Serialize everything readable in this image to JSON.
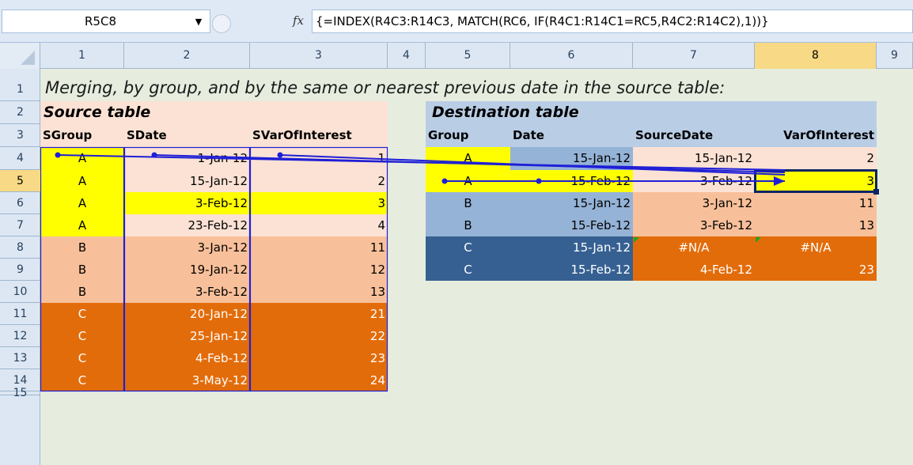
{
  "formula_bar": {
    "name_box": "R5C8",
    "fx_icon": "fx-icon",
    "formula": "{=INDEX(R4C3:R14C3, MATCH(RC6, IF(R4C1:R14C1=RC5,R4C2:R14C2),1))}"
  },
  "columns": [
    "1",
    "2",
    "3",
    "4",
    "5",
    "6",
    "7",
    "8",
    "9"
  ],
  "rows": [
    "1",
    "2",
    "3",
    "4",
    "5",
    "6",
    "7",
    "8",
    "9",
    "10",
    "11",
    "12",
    "13",
    "14",
    "15"
  ],
  "title": "Merging, by group, and by the same or nearest previous date in the source table:",
  "source": {
    "heading": "Source table",
    "headers": [
      "SGroup",
      "SDate",
      "SVarOfInterest"
    ],
    "rows": [
      [
        "A",
        "1-Jan-12",
        "1"
      ],
      [
        "A",
        "15-Jan-12",
        "2"
      ],
      [
        "A",
        "3-Feb-12",
        "3"
      ],
      [
        "A",
        "23-Feb-12",
        "4"
      ],
      [
        "B",
        "3-Jan-12",
        "11"
      ],
      [
        "B",
        "19-Jan-12",
        "12"
      ],
      [
        "B",
        "3-Feb-12",
        "13"
      ],
      [
        "C",
        "20-Jan-12",
        "21"
      ],
      [
        "C",
        "25-Jan-12",
        "22"
      ],
      [
        "C",
        "4-Feb-12",
        "23"
      ],
      [
        "C",
        "3-May-12",
        "24"
      ]
    ]
  },
  "destination": {
    "heading": "Destination table",
    "headers": [
      "Group",
      "Date",
      "SourceDate",
      "VarOfInterest"
    ],
    "rows": [
      [
        "A",
        "15-Jan-12",
        "15-Jan-12",
        "2"
      ],
      [
        "A",
        "15-Feb-12",
        "3-Feb-12",
        "3"
      ],
      [
        "B",
        "15-Jan-12",
        "3-Jan-12",
        "11"
      ],
      [
        "B",
        "15-Feb-12",
        "3-Feb-12",
        "13"
      ],
      [
        "C",
        "15-Jan-12",
        "#N/A",
        "#N/A"
      ],
      [
        "C",
        "15-Feb-12",
        "4-Feb-12",
        "23"
      ]
    ]
  },
  "colors": {
    "peach": "#fbe2d4",
    "orange_light": "#f8c09a",
    "orange": "#e36c0a",
    "yellow": "#ffff00",
    "blue_light": "#b9cde5",
    "blue_mid": "#95b3d7",
    "blue_dark": "#366092",
    "precedent_arrow": "#1f1fd6",
    "active_border": "#0b2466"
  }
}
